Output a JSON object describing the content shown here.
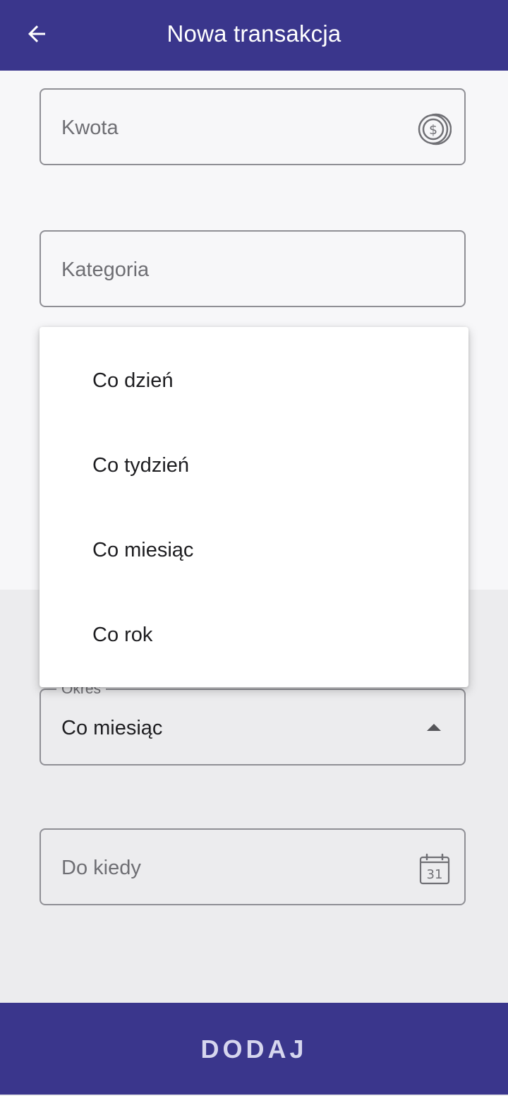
{
  "appbar": {
    "title": "Nowa transakcja",
    "back_icon": "arrow-left-icon"
  },
  "fields": {
    "amount": {
      "placeholder": "Kwota",
      "icon": "coin-dollar-icon"
    },
    "category": {
      "placeholder": "Kategoria"
    },
    "period": {
      "label": "Okres",
      "value": "Co miesiąc",
      "icon": "arrow-drop-up-icon"
    },
    "until": {
      "placeholder": "Do kiedy",
      "icon": "calendar-icon",
      "calendar_day": "31"
    }
  },
  "period_menu": {
    "options": [
      "Co dzień",
      "Co tydzień",
      "Co miesiąc",
      "Co rok"
    ]
  },
  "submit": {
    "label": "DODAJ"
  },
  "colors": {
    "primary": "#3a368c",
    "on_primary_button_text": "#d6d6ee",
    "surface": "#f7f7f9",
    "background_dimmed": "#ececee"
  }
}
